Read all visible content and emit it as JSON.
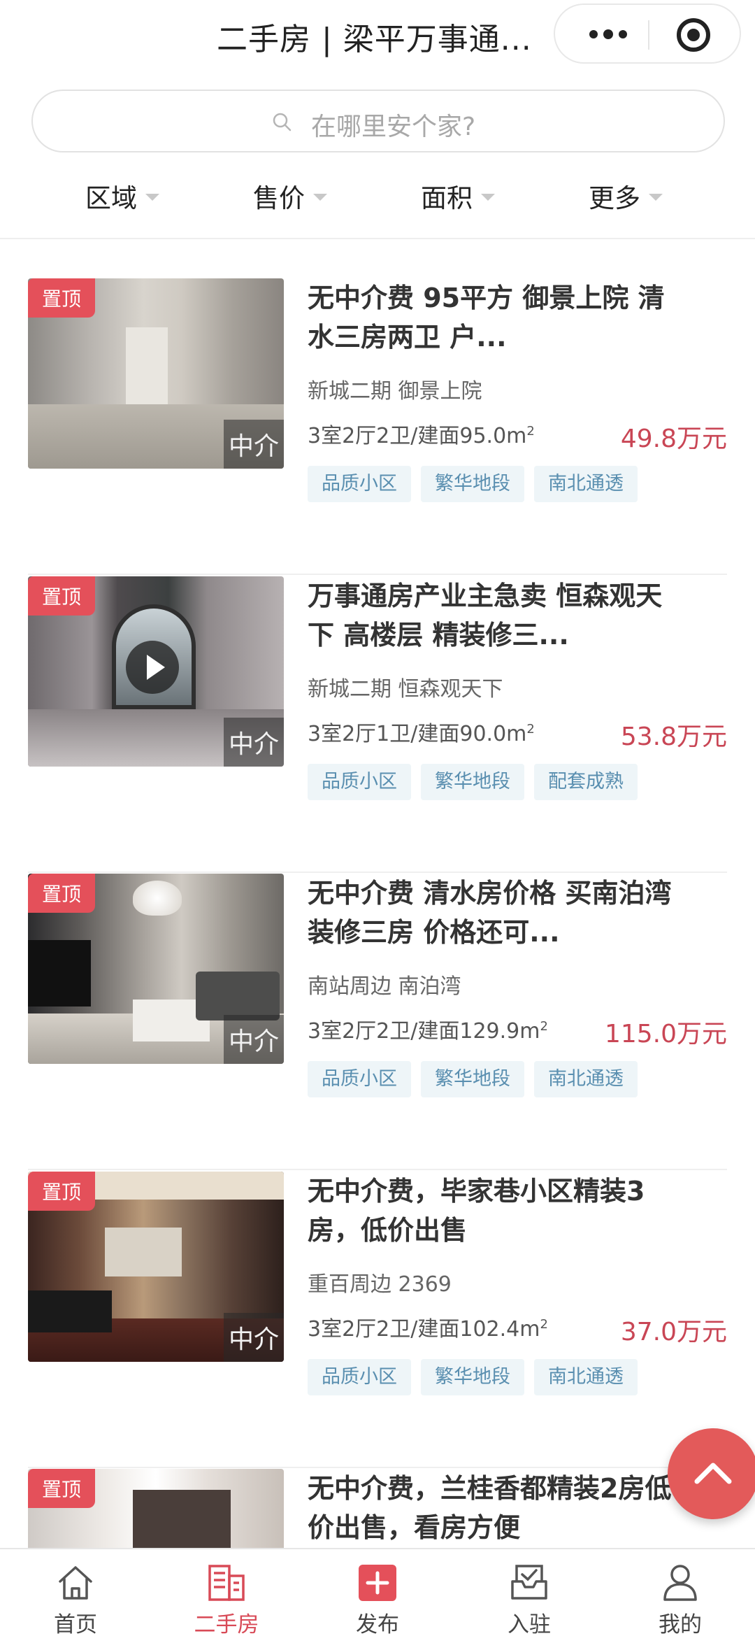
{
  "header": {
    "title": "二手房 | 梁平万事通..."
  },
  "search": {
    "placeholder": "在哪里安个家?"
  },
  "filters": [
    "区域",
    "售价",
    "面积",
    "更多"
  ],
  "listings": [
    {
      "tag": "置顶",
      "agent": "中介",
      "title_line1": "无中介费 95平方 御景上院 清",
      "title_line2": "水三房两卫 户...",
      "location": "新城二期 御景上院",
      "spec": "3室2厅2卫/建面95.0m",
      "spec_sup": "2",
      "price": "49.8万元",
      "tags": [
        "品质小区",
        "繁华地段",
        "南北通透"
      ]
    },
    {
      "tag": "置顶",
      "agent": "中介",
      "title_line1": "万事通房产业主急卖 恒森观天",
      "title_line2": "下 高楼层 精装修三...",
      "location": "新城二期 恒森观天下",
      "spec": "3室2厅1卫/建面90.0m",
      "spec_sup": "2",
      "price": "53.8万元",
      "tags": [
        "品质小区",
        "繁华地段",
        "配套成熟"
      ]
    },
    {
      "tag": "置顶",
      "agent": "中介",
      "title_line1": "无中介费 清水房价格 买南泊湾",
      "title_line2": "装修三房 价格还可...",
      "location": "南站周边 南泊湾",
      "spec": "3室2厅2卫/建面129.9m",
      "spec_sup": "2",
      "price": "115.0万元",
      "tags": [
        "品质小区",
        "繁华地段",
        "南北通透"
      ]
    },
    {
      "tag": "置顶",
      "agent": "中介",
      "title_line1": "无中介费，毕家巷小区精装3",
      "title_line2": "房，低价出售",
      "location": "重百周边 2369",
      "spec": "3室2厅2卫/建面102.4m",
      "spec_sup": "2",
      "price": "37.0万元",
      "tags": [
        "品质小区",
        "繁华地段",
        "南北通透"
      ]
    },
    {
      "tag": "置顶",
      "title_line1": "无中介费，兰桂香都精装2房低",
      "title_line2": "价出售，看房方便"
    }
  ],
  "tabbar": [
    "首页",
    "二手房",
    "发布",
    "入驻",
    "我的"
  ],
  "colors": {
    "accent": "#d84a57",
    "price": "#c94655",
    "tag_bg": "#eef5f8",
    "tag_text": "#5a8fb0"
  }
}
